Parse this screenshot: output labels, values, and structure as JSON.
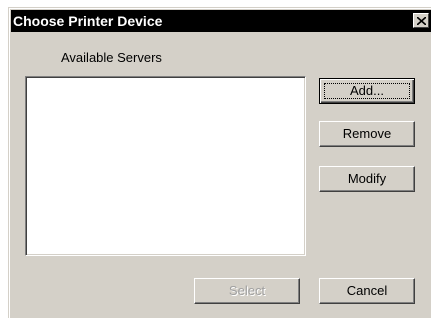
{
  "window": {
    "title": "Choose Printer Device",
    "close_icon": "close-icon"
  },
  "servers": {
    "label": "Available Servers",
    "items": []
  },
  "buttons": {
    "add": "Add...",
    "remove": "Remove",
    "modify": "Modify",
    "select": "Select",
    "cancel": "Cancel"
  },
  "colors": {
    "titlebar_bg": "#000000",
    "titlebar_text": "#ffffff",
    "dialog_bg": "#d4d0c8",
    "disabled_text": "#a0a0a0"
  }
}
